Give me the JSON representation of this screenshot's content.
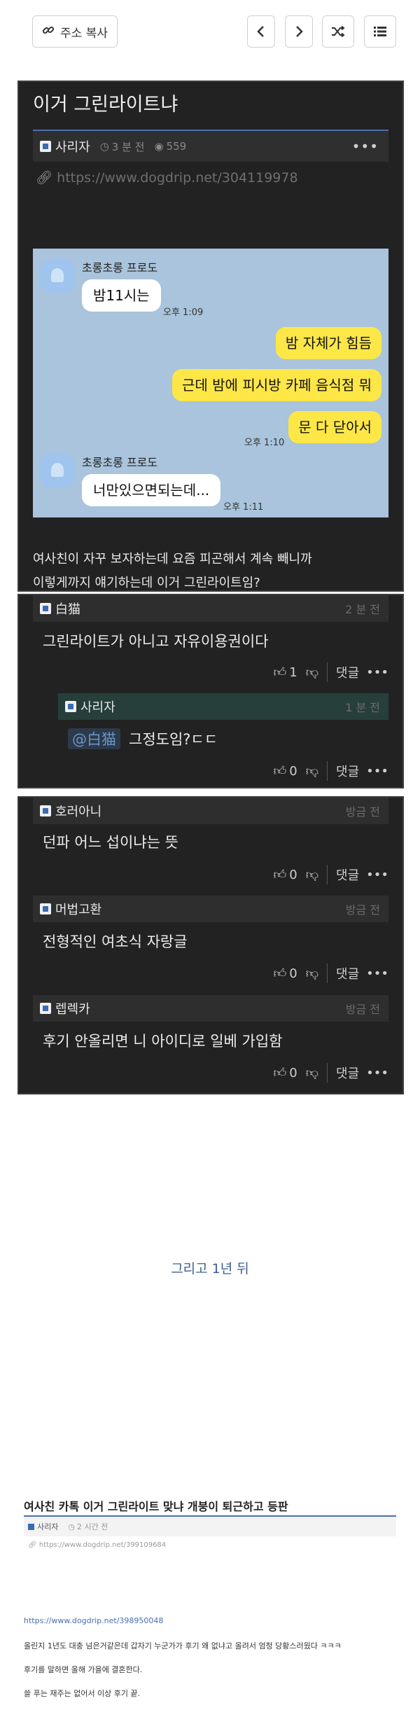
{
  "toolbar": {
    "copy_label": "주소 복사",
    "link_icon": "link-icon",
    "prev_icon": "chevron-left-icon",
    "next_icon": "chevron-right-icon",
    "shuffle_icon": "shuffle-icon",
    "list_icon": "list-icon"
  },
  "post": {
    "title": "이거 그린라이트냐",
    "author": "사리자",
    "time": "3 분 전",
    "views": "559",
    "url": "https://www.dogdrip.net/304119978",
    "body_line1": "여사친이 자꾸 보자하는데 요즘 피곤해서 계속 빼니까",
    "body_line2": "이렇게까지 얘기하는데 이거 그린라이트임?"
  },
  "chat": {
    "sender_name": "초롱초롱 프로도",
    "msg1": "밤11시는",
    "time1": "오후 1:09",
    "me_msg1": "밤 자체가 힘듬",
    "me_msg2": "근데 밤에 피시방 카페 음식점 뭐",
    "me_msg3": "문 다 닫아서",
    "time2": "오후 1:10",
    "msg2": "너만있으면되는데...",
    "time3": "오후 1:11"
  },
  "comments1": [
    {
      "author": "白猫",
      "time": "2 분 전",
      "text": "그린라이트가 아니고 자유이용권이다",
      "likes": "1",
      "reply_label": "댓글"
    },
    {
      "author": "사리자",
      "time": "1 분 전",
      "mention": "@白猫",
      "text": "그정도임?ㄷㄷ",
      "likes": "0",
      "reply_label": "댓글"
    }
  ],
  "comments2": [
    {
      "author": "호러아니",
      "time": "방금 전",
      "text": "던파 어느 섭이냐는 뜻",
      "likes": "0",
      "reply_label": "댓글"
    },
    {
      "author": "머법고환",
      "time": "방금 전",
      "text": "전형적인 여초식 자랑글",
      "likes": "0",
      "reply_label": "댓글"
    },
    {
      "author": "렙렉카",
      "time": "방금 전",
      "text": "후기 안올리면 니 아이디로 일베 가입함",
      "likes": "0",
      "reply_label": "댓글"
    }
  ],
  "middle_text": "그리고 1년 뒤",
  "bottom": {
    "title": "여사친 카톡 이거 그린라이트 맞냐 개붕이 퇴근하고 등판",
    "author": "사리자",
    "time": "2 시간 전",
    "url": "https://www.dogdrip.net/399109684",
    "link": "https://www.dogdrip.net/398950048",
    "line1": "올린지 1년도 대충 넘은거같은데 갑자기 누군가가 후기 왜 없냐고 올려서 엄청 당황스러웠다 ㅋㅋㅋ",
    "line2": "후기를 말하면 올해 가을에 결혼한다.",
    "line3": "쓸 푸는 재주는 없어서 이상 후기 끝."
  }
}
